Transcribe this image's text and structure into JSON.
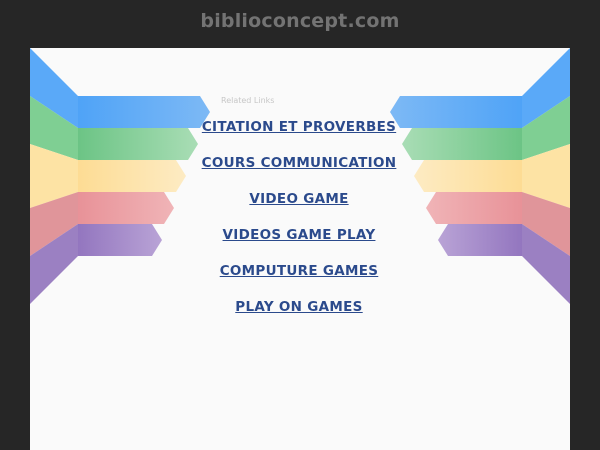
{
  "header": {
    "domain": "biblioconcept.com"
  },
  "related": {
    "heading": "Related Links"
  },
  "links": [
    {
      "label": "CITATION ET PROVERBES"
    },
    {
      "label": "COURS COMMUNICATION"
    },
    {
      "label": "VIDEO GAME"
    },
    {
      "label": "VIDEOS GAME PLAY"
    },
    {
      "label": "COMPUTURE GAMES"
    },
    {
      "label": "PLAY ON GAMES"
    }
  ],
  "colors": {
    "background": "#262626",
    "panel": "#fafafa",
    "link": "#2b4a8c",
    "ribbon_blue": "#5aa9f8",
    "ribbon_green": "#7fcf93",
    "ribbon_yellow": "#fde3a4",
    "ribbon_pink": "#e99ea3",
    "ribbon_purple": "#9b80c2"
  }
}
